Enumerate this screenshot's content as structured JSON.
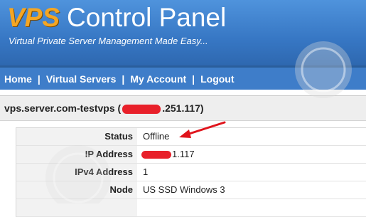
{
  "header": {
    "brand": "VPS",
    "title_rest": "Control Panel",
    "tagline": "Virtual Private Server Management Made Easy..."
  },
  "nav": {
    "items": [
      "Home",
      "Virtual Servers",
      "My Account",
      "Logout"
    ],
    "separator": "|"
  },
  "server": {
    "title_prefix": "vps.server.com-testvps (",
    "title_suffix": ".251.117)"
  },
  "details": {
    "status_label": "Status",
    "status_value": "Offline",
    "ip_label": "IP Address",
    "ip_suffix": "1.117",
    "ipv4_label": "IPv4 Address",
    "ipv4_value": "1",
    "node_label": "Node",
    "node_value": "US SSD Windows 3"
  },
  "colors": {
    "header_blue": "#3a7fcc",
    "brand_orange": "#f5a623",
    "offline_red": "#e0141c"
  }
}
